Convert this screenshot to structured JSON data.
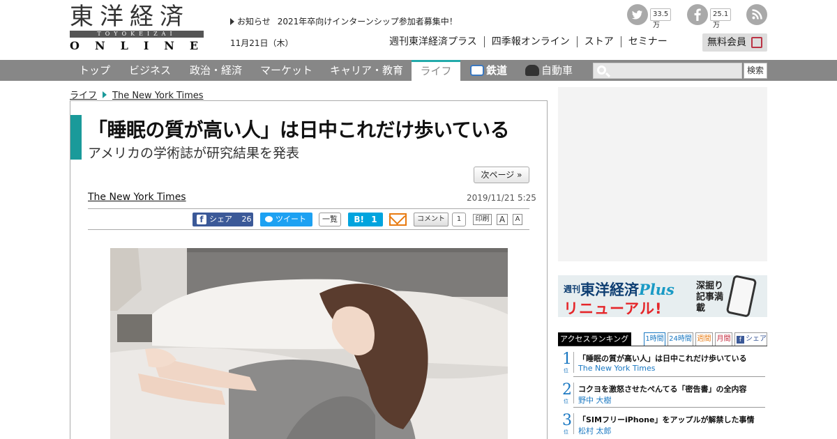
{
  "header": {
    "logo_kanji": "東洋経済",
    "logo_romaji": "TOYOKEIZAI",
    "logo_online": "ONLINE",
    "notice_label": "お知らせ",
    "notice_text": "2021年卒向けインターンシップ参加者募集中！",
    "date": "11月21日（木）",
    "top_links": [
      "週刊東洋経済プラス",
      "四季報オンライン",
      "ストア",
      "セミナー"
    ],
    "member_label": "無料会員",
    "social": {
      "twitter_count": "33.5万",
      "facebook_count": "25.1万"
    }
  },
  "navbar": {
    "items": [
      "トップ",
      "ビジネス",
      "政治・経済",
      "マーケット",
      "キャリア・教育",
      "ライフ",
      "鉄道",
      "自動車"
    ],
    "active": "ライフ",
    "search_button": "検索"
  },
  "breadcrumb": {
    "section": "ライフ",
    "source": "The New York Times"
  },
  "article": {
    "title": "「睡眠の質が高い人」は日中これだけ歩いている",
    "subtitle": "アメリカの学術誌が研究結果を発表",
    "next_page": "次ページ »",
    "author": "The New York Times",
    "date": "2019/11/21 5:25",
    "share": {
      "fb_label": "シェア",
      "fb_count": "26",
      "tweet_label": "ツイート",
      "list_label": "一覧",
      "hatena_label": "B!",
      "hatena_count": "1",
      "comment_label": "コメント",
      "comment_count": "1",
      "print_label": "印刷",
      "font_large": "A",
      "font_small": "A"
    }
  },
  "sidebar": {
    "banner": {
      "weekly_prefix": "週刊",
      "weekly_title": "東洋経済",
      "weekly_plus": "Plus",
      "renewal": "リニューアル!",
      "deep_dive": "深掘り記事満載"
    },
    "ranking": {
      "title": "アクセスランキング",
      "tabs": [
        "1時間",
        "24時間",
        "週間",
        "月間",
        "シェア"
      ],
      "rank_suffix": "位",
      "items": [
        {
          "rank": "1",
          "title": "「睡眠の質が高い人」は日中これだけ歩いている",
          "author": "The New York Times"
        },
        {
          "rank": "2",
          "title": "コクヨを激怒させたぺんてる「密告書」の全内容",
          "author": "野中 大樹"
        },
        {
          "rank": "3",
          "title": "「SIMフリーiPhone」をアップルが解禁した事情",
          "author": "松村 太郎"
        }
      ]
    }
  },
  "colors": {
    "accent": "#1a9a9a",
    "navbar": "#878787",
    "facebook": "#3b5998",
    "twitter": "#1da1f2",
    "hatena": "#00a4de",
    "link_blue": "#1a78c2"
  }
}
